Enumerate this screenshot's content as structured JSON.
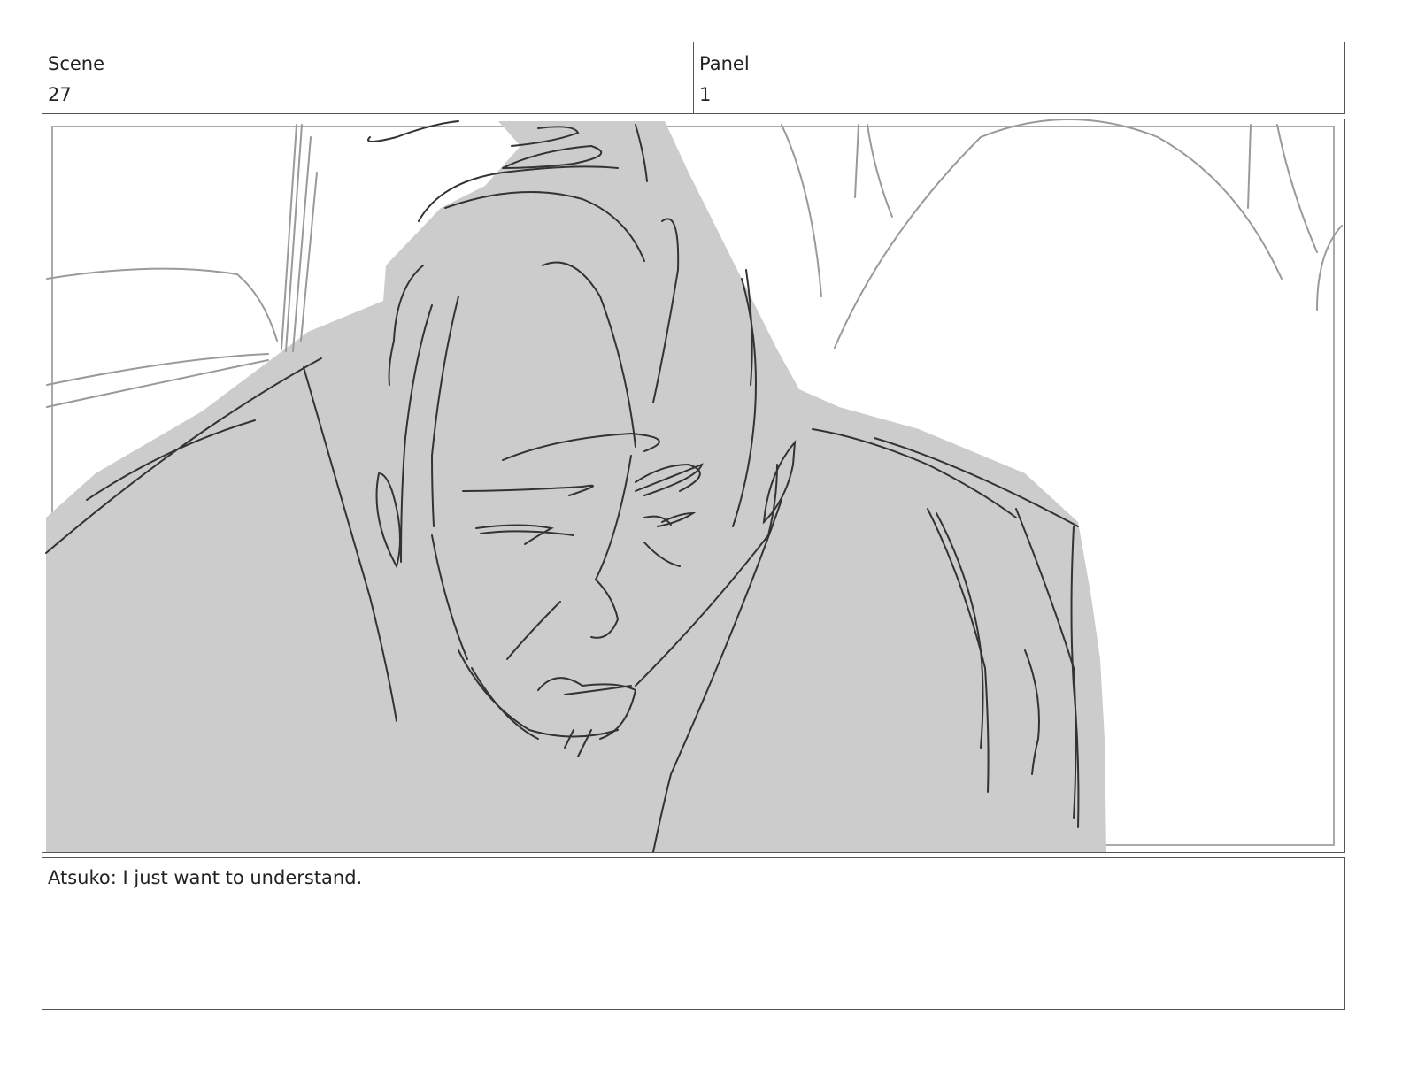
{
  "header": {
    "scene_label": "Scene",
    "scene_value": "27",
    "panel_label": "Panel",
    "panel_value": "1"
  },
  "sketch": {
    "subject": "storyboard-sketch-man-looking-down",
    "fill_color": "#cccccc",
    "line_color": "#333333"
  },
  "caption": {
    "text": "Atsuko: I just want to understand."
  }
}
